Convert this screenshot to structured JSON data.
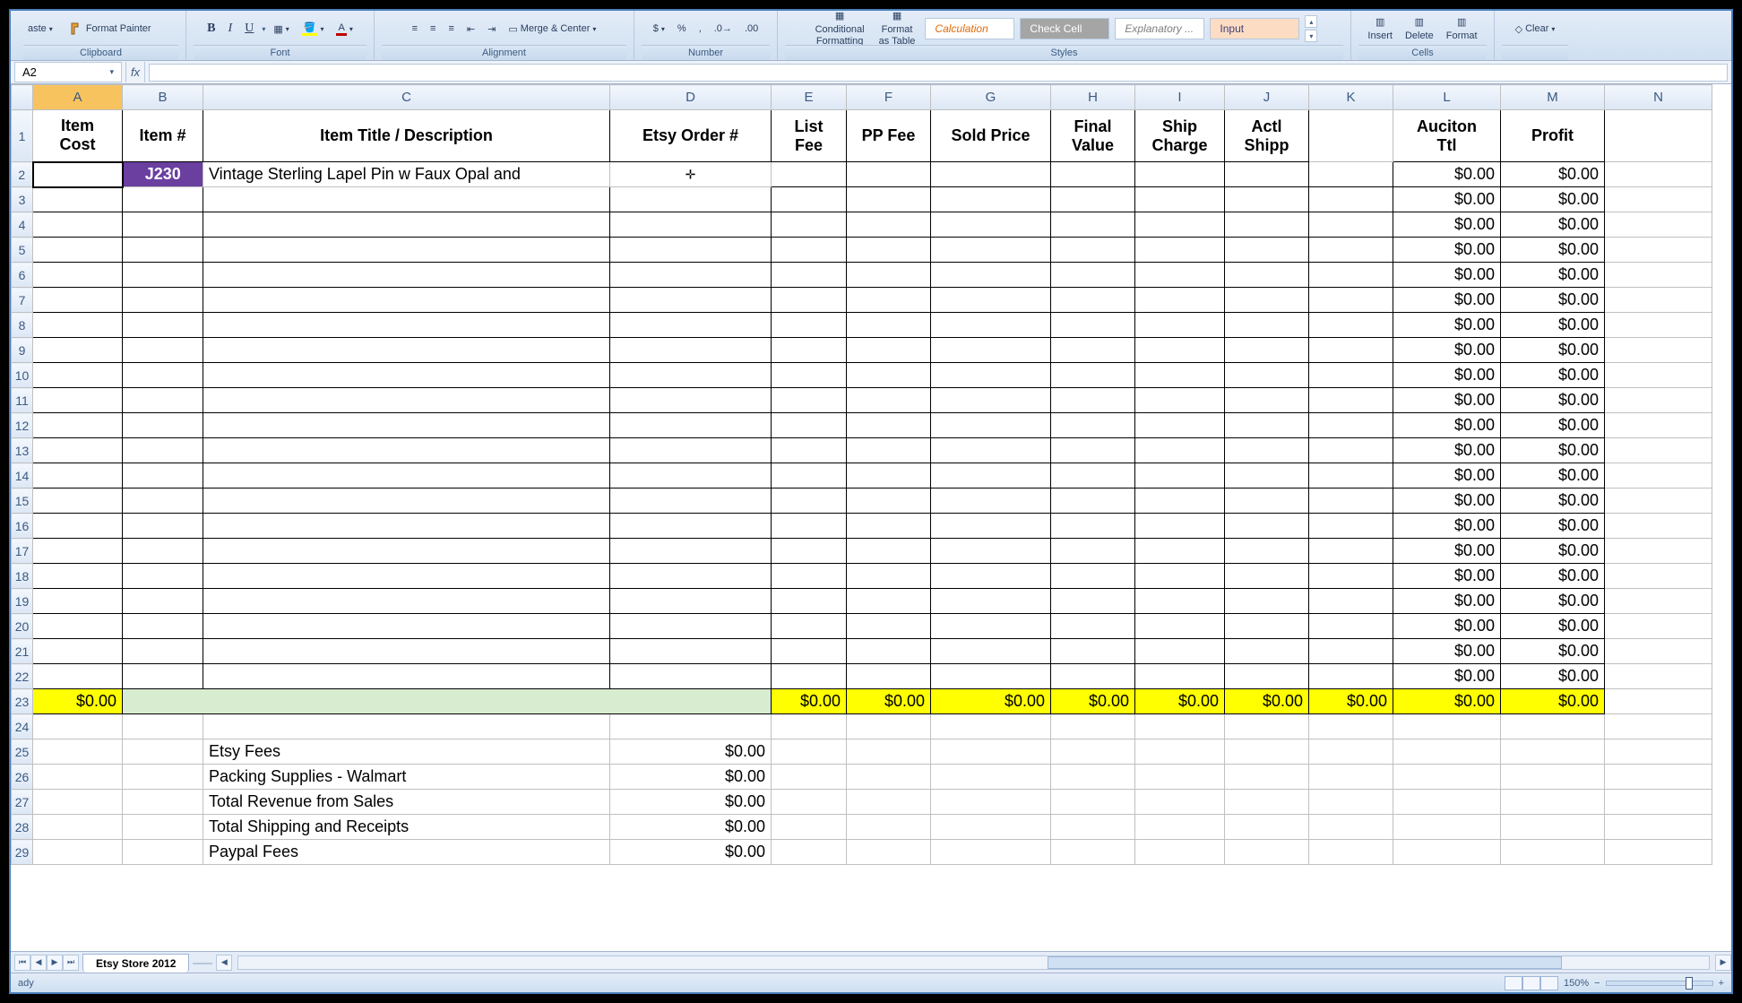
{
  "ribbon": {
    "paste": "aste",
    "format_painter": "Format Painter",
    "clipboard": "Clipboard",
    "font_group": "Font",
    "alignment": "Alignment",
    "merge_center": "Merge & Center",
    "number": "Number",
    "conditional": "Conditional\nFormatting",
    "format_table": "Format\nas Table",
    "styles": "Styles",
    "calculation": "Calculation",
    "check_cell": "Check Cell",
    "explanatory": "Explanatory ...",
    "input": "Input",
    "insert": "Insert",
    "delete": "Delete",
    "format": "Format",
    "cells": "Cells",
    "clear": "Clear"
  },
  "formula_bar": {
    "name_box": "A2",
    "fx": "fx",
    "formula": ""
  },
  "columns": [
    "A",
    "B",
    "C",
    "D",
    "E",
    "F",
    "G",
    "H",
    "I",
    "J",
    "K",
    "L",
    "M",
    "N"
  ],
  "headers": {
    "A": [
      "Item",
      "Cost"
    ],
    "B": [
      "",
      "Item #"
    ],
    "C": [
      "",
      "Item Title / Description"
    ],
    "D": [
      "",
      "Etsy Order #"
    ],
    "E": [
      "List",
      "Fee"
    ],
    "F": [
      "",
      "PP Fee"
    ],
    "G": [
      "",
      "Sold Price"
    ],
    "H": [
      "Final",
      "Value"
    ],
    "I": [
      "Ship",
      "Charge"
    ],
    "J": [
      "Actl",
      "Shipp"
    ],
    "K": [
      "",
      ""
    ],
    "L": [
      "Auciton",
      "Ttl"
    ],
    "M": [
      "",
      "Profit"
    ],
    "N": [
      "",
      ""
    ]
  },
  "row2": {
    "item_num": "J230",
    "desc": "Vintage Sterling Lapel Pin w Faux Opal and",
    "L": "$0.00",
    "M": "$0.00"
  },
  "zero": "$0.00",
  "totals_row": {
    "A": "$0.00",
    "E": "$0.00",
    "F": "$0.00",
    "G": "$0.00",
    "H": "$0.00",
    "I": "$0.00",
    "J": "$0.00",
    "K": "$0.00",
    "L": "$0.00",
    "M": "$0.00"
  },
  "summary": [
    {
      "label": "Etsy Fees",
      "value": "$0.00"
    },
    {
      "label": "Packing Supplies - Walmart",
      "value": "$0.00"
    },
    {
      "label": "Total Revenue from Sales",
      "value": "$0.00"
    },
    {
      "label": "Total Shipping and Receipts",
      "value": "$0.00"
    },
    {
      "label": "Paypal Fees",
      "value": "$0.00"
    }
  ],
  "sheet_tab": "Etsy Store 2012",
  "status": "ady",
  "zoom": "150%"
}
